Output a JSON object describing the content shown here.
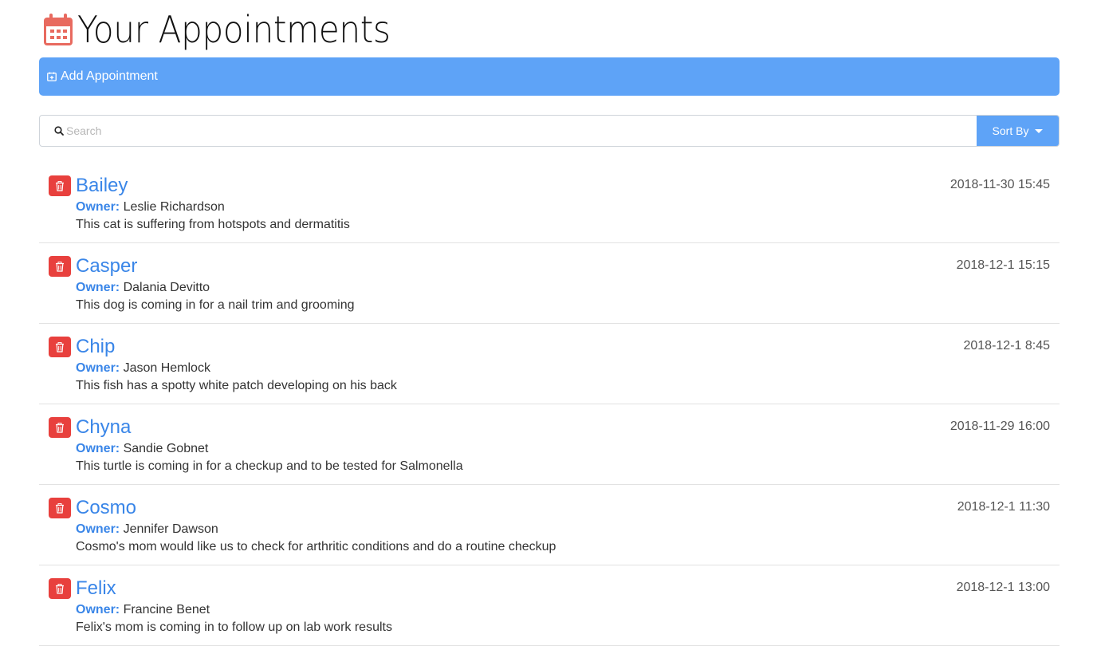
{
  "header": {
    "title": "Your Appointments",
    "icon": "calendar-icon",
    "icon_color": "#e86a5f"
  },
  "add_bar": {
    "label": "Add Appointment",
    "icon": "calendar-plus-icon",
    "color": "#5ea3f7"
  },
  "search": {
    "placeholder": "Search",
    "value": "",
    "sort_label": "Sort By"
  },
  "colors": {
    "accent": "#3a86e8",
    "delete": "#e8403d"
  },
  "owner_label": "Owner:",
  "appointments": [
    {
      "pet": "Bailey",
      "date": "2018-11-30 15:45",
      "owner": "Leslie Richardson",
      "notes": "This cat is suffering from hotspots and dermatitis"
    },
    {
      "pet": "Casper",
      "date": "2018-12-1 15:15",
      "owner": "Dalania Devitto",
      "notes": "This dog is coming in for a nail trim and grooming"
    },
    {
      "pet": "Chip",
      "date": "2018-12-1 8:45",
      "owner": "Jason Hemlock",
      "notes": "This fish has a spotty white patch developing on his back"
    },
    {
      "pet": "Chyna",
      "date": "2018-11-29 16:00",
      "owner": "Sandie Gobnet",
      "notes": "This turtle is coming in for a checkup and to be tested for Salmonella"
    },
    {
      "pet": "Cosmo",
      "date": "2018-12-1 11:30",
      "owner": "Jennifer Dawson",
      "notes": "Cosmo's mom would like us to check for arthritic conditions and do a routine checkup"
    },
    {
      "pet": "Felix",
      "date": "2018-12-1 13:00",
      "owner": "Francine Benet",
      "notes": "Felix's mom is coming in to follow up on lab work results"
    }
  ]
}
